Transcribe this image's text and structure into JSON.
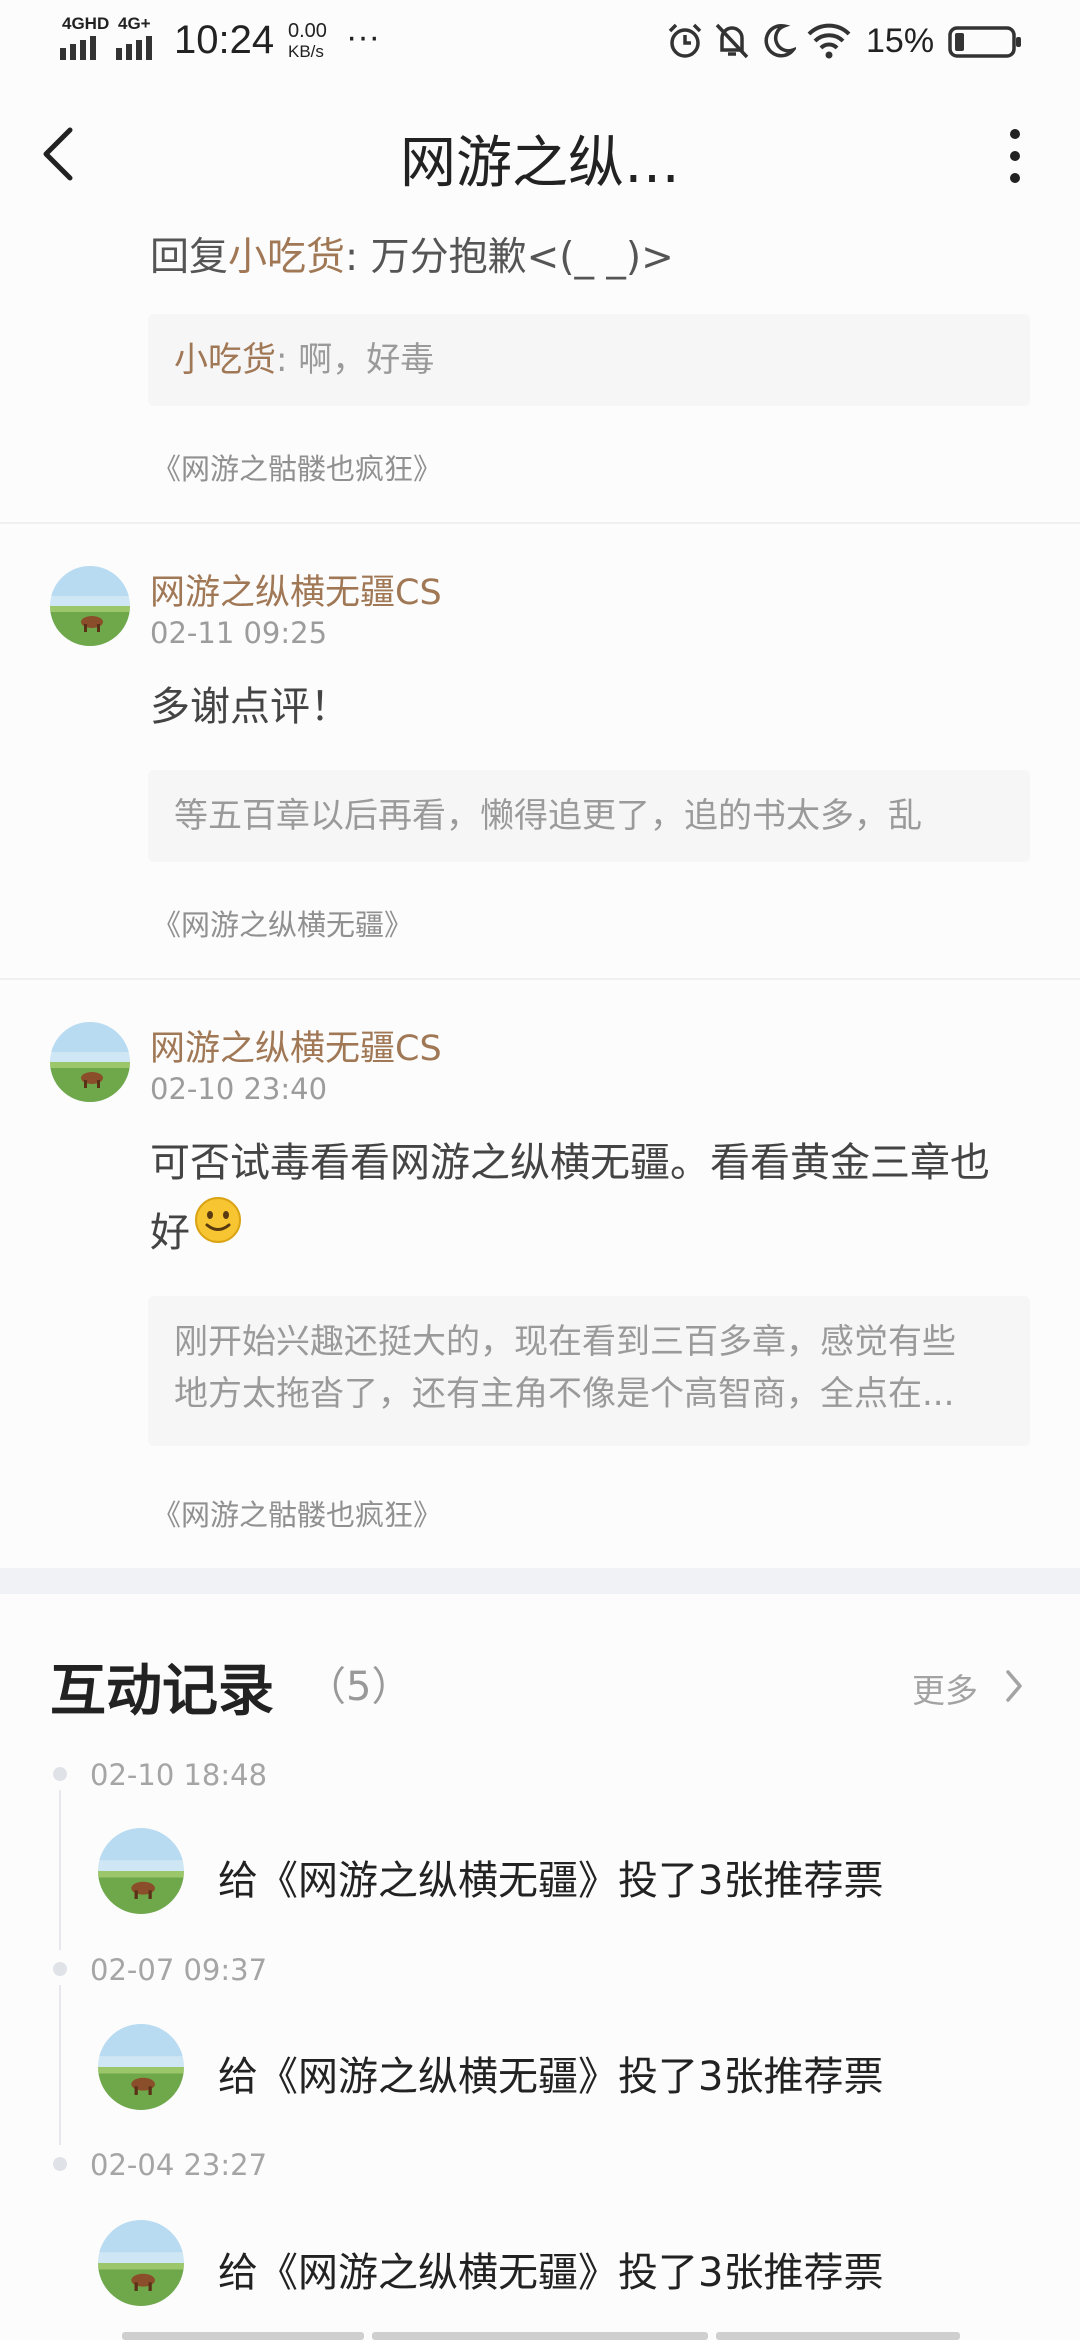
{
  "status_bar": {
    "network1": "4GHD",
    "network2": "4G+",
    "time": "10:24",
    "speed_value": "0.00",
    "speed_unit": "KB/s",
    "dots": "···",
    "battery": "15%"
  },
  "header": {
    "title": "网游之纵…"
  },
  "comments": [
    {
      "reply_prefix": "回复",
      "reply_user": "小吃货",
      "reply_text": ": 万分抱歉<(_ _)>",
      "quote_user": "小吃货",
      "quote_text": ": 啊，好毒",
      "book": "《网游之骷髅也疯狂》"
    },
    {
      "name": "网游之纵横无疆CS",
      "time": "02-11 09:25",
      "text": "多谢点评！",
      "quote_text": "等五百章以后再看，懒得追更了，追的书太多，乱",
      "book": "《网游之纵横无疆》"
    },
    {
      "name": "网游之纵横无疆CS",
      "time": "02-10 23:40",
      "text_line1": "可否试毒看看网游之纵横无疆。看看黄金三章也",
      "text_line2": "好",
      "emoji": "smiley-emoji",
      "quote_line1": "刚开始兴趣还挺大的，现在看到三百多章，感觉有些",
      "quote_line2": "地方太拖沓了，还有主角不像是个高智商，全点在...",
      "book": "《网游之骷髅也疯狂》"
    }
  ],
  "records": {
    "title": "互动记录",
    "count": "（5）",
    "more": "更多",
    "items": [
      {
        "time": "02-10 18:48",
        "text": "给《网游之纵横无疆》投了3张推荐票"
      },
      {
        "time": "02-07 09:37",
        "text": "给《网游之纵横无疆》投了3张推荐票"
      },
      {
        "time": "02-04 23:27",
        "text": "给《网游之纵横无疆》投了3张推荐票"
      }
    ]
  },
  "colors": {
    "username": "#a07856",
    "quote_bg": "#f6f6f7",
    "section_bg": "#f0f2f5"
  },
  "icons": [
    "signal-icon",
    "alarm-icon",
    "mute-icon",
    "moon-icon",
    "wifi-icon",
    "battery-icon",
    "back-arrow-icon",
    "more-vertical-icon",
    "chevron-right-icon",
    "avatar-icon",
    "smiley-emoji"
  ]
}
